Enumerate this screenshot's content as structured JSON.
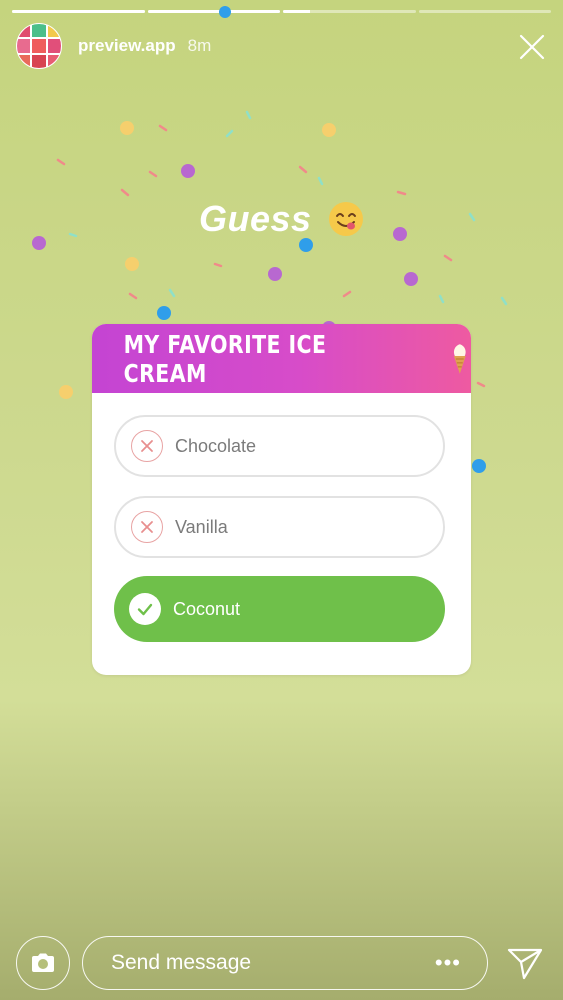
{
  "story": {
    "progress_segments": [
      1,
      1,
      0.2,
      0
    ],
    "username": "preview.app",
    "time": "8m"
  },
  "sticker": {
    "headline": "Guess"
  },
  "quiz": {
    "title": "MY FAVORITE ICE CREAM",
    "options": [
      {
        "label": "Chocolate",
        "state": "incorrect"
      },
      {
        "label": "Vanilla",
        "state": "incorrect"
      },
      {
        "label": "Coconut",
        "state": "correct"
      }
    ]
  },
  "reply": {
    "placeholder": "Send message",
    "more": "•••"
  },
  "colors": {
    "correct": "#6fc04a",
    "header_gradient_start": "#c444d3",
    "header_gradient_end": "#ee5aa1",
    "incorrect_mark": "#e8a3a3"
  },
  "icons": {
    "close": "close-icon",
    "camera": "camera-icon",
    "send": "send-icon",
    "incorrect": "x-circle-icon",
    "correct": "check-circle-icon"
  }
}
